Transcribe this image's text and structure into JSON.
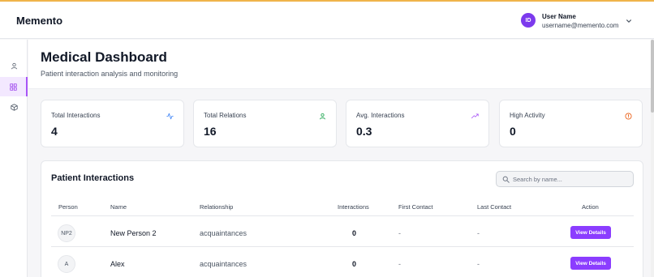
{
  "app": {
    "brand": "Memento"
  },
  "user": {
    "initials": "ID",
    "name": "User Name",
    "email": "username@memento.com"
  },
  "page": {
    "title": "Medical Dashboard",
    "subtitle": "Patient interaction analysis and monitoring"
  },
  "sidebar": {
    "items": [
      {
        "icon": "person-icon"
      },
      {
        "icon": "grid-icon",
        "active": true
      },
      {
        "icon": "cube-icon"
      }
    ]
  },
  "stats": [
    {
      "label": "Total Interactions",
      "value": "4",
      "icon": "activity-icon",
      "color": "#3b82f6"
    },
    {
      "label": "Total Relations",
      "value": "16",
      "icon": "user-icon",
      "color": "#16a34a"
    },
    {
      "label": "Avg. Interactions",
      "value": "0.3",
      "icon": "trending-up-icon",
      "color": "#a855f7"
    },
    {
      "label": "High Activity",
      "value": "0",
      "icon": "alert-circle-icon",
      "color": "#ea580c"
    }
  ],
  "table": {
    "title": "Patient Interactions",
    "search_placeholder": "Search by name...",
    "columns": [
      "Person",
      "Name",
      "Relationship",
      "Interactions",
      "First Contact",
      "Last Contact",
      "Action"
    ],
    "rows": [
      {
        "initials": "NP2",
        "name": "New Person 2",
        "relationship": "acquaintances",
        "interactions": "0",
        "first_contact": "-",
        "last_contact": "-",
        "action": "View Details"
      },
      {
        "initials": "A",
        "name": "Alex",
        "relationship": "acquaintances",
        "interactions": "0",
        "first_contact": "-",
        "last_contact": "-",
        "action": "View Details"
      }
    ]
  },
  "colors": {
    "accent": "#8b3dff",
    "avatar": "#7c3aed",
    "top_line": "#f0b44a"
  }
}
